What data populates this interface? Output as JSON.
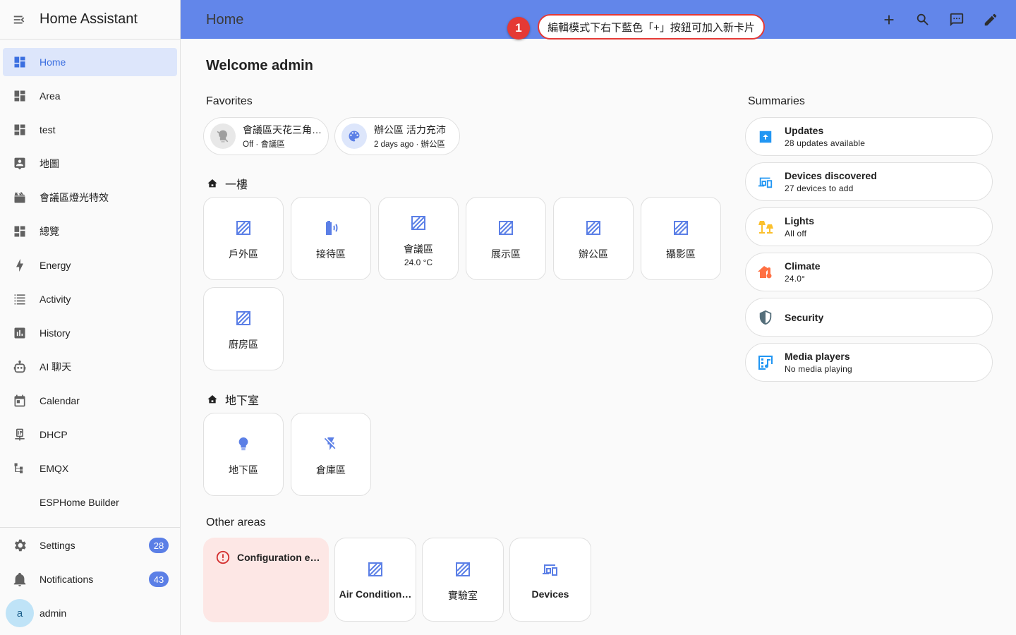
{
  "app": {
    "title": "Home Assistant"
  },
  "sidebar": {
    "items": [
      {
        "label": "Home",
        "icon": "dashboard-icon",
        "selected": true
      },
      {
        "label": "Area",
        "icon": "dashboard-icon"
      },
      {
        "label": "test",
        "icon": "dashboard-icon"
      },
      {
        "label": "地圖",
        "icon": "map-account-icon"
      },
      {
        "label": "會議區燈光特效",
        "icon": "movie-open-icon"
      },
      {
        "label": "總覽",
        "icon": "dashboard-icon"
      },
      {
        "label": "Energy",
        "icon": "lightning-bolt-icon"
      },
      {
        "label": "Activity",
        "icon": "format-list-bulleted-icon"
      },
      {
        "label": "History",
        "icon": "chart-box-icon"
      },
      {
        "label": "AI 聊天",
        "icon": "robot-icon"
      },
      {
        "label": "Calendar",
        "icon": "calendar-icon"
      },
      {
        "label": "DHCP",
        "icon": "ip-network-icon"
      },
      {
        "label": "EMQX",
        "icon": "sitemap-icon"
      },
      {
        "label": "ESPHome Builder",
        "icon": ""
      }
    ],
    "bottom": {
      "settings": {
        "label": "Settings",
        "badge": "28"
      },
      "notifications": {
        "label": "Notifications",
        "badge": "43"
      },
      "user": {
        "label": "admin",
        "initial": "a"
      }
    }
  },
  "topbar": {
    "title": "Home",
    "actions": [
      "add-icon",
      "search-icon",
      "assist-chat-icon",
      "edit-pencil-icon"
    ],
    "tip": {
      "number": "1",
      "text": "編輯模式下右下藍色「+」按鈕可加入新卡片"
    }
  },
  "main": {
    "welcome": "Welcome admin",
    "favorites": {
      "title": "Favorites",
      "items": [
        {
          "name": "會議區天花三角…",
          "sub": "Off · 會議區",
          "icon": "lightbulb-off-icon"
        },
        {
          "name": "辦公區 活力充沛",
          "sub": "2 days ago · 辦公區",
          "icon": "palette-icon"
        }
      ]
    },
    "floors": [
      {
        "title": "一樓",
        "areas": [
          {
            "name": "戶外區",
            "icon": "area-placeholder-icon"
          },
          {
            "name": "接待區",
            "icon": "battery-sound-icon"
          },
          {
            "name": "會議區",
            "temp": "24.0 °C",
            "icon": "area-placeholder-icon"
          },
          {
            "name": "展示區",
            "icon": "area-placeholder-icon"
          },
          {
            "name": "辦公區",
            "icon": "area-placeholder-icon"
          },
          {
            "name": "攝影區",
            "icon": "area-placeholder-icon"
          },
          {
            "name": "廚房區",
            "icon": "area-placeholder-icon"
          }
        ]
      },
      {
        "title": "地下室",
        "areas": [
          {
            "name": "地下區",
            "icon": "lightbulb-icon"
          },
          {
            "name": "倉庫區",
            "icon": "flash-off-icon"
          }
        ]
      }
    ],
    "other_areas": {
      "title": "Other areas",
      "error": {
        "text": "Configuration er…",
        "icon": "alert-circle-icon"
      },
      "items": [
        {
          "name": "Air Condition…",
          "icon": "area-placeholder-icon"
        },
        {
          "name": "實驗室",
          "icon": "area-placeholder-icon"
        },
        {
          "name": "Devices",
          "icon": "devices-icon"
        }
      ]
    },
    "summaries": {
      "title": "Summaries",
      "items": [
        {
          "name": "Updates",
          "sub": "28 updates available",
          "icon": "package-up-icon",
          "color": "#2196f3"
        },
        {
          "name": "Devices discovered",
          "sub": "27 devices to add",
          "icon": "devices-icon",
          "color": "#2196f3"
        },
        {
          "name": "Lights",
          "sub": "All off",
          "icon": "lamps-icon",
          "color": "#fbc02d"
        },
        {
          "name": "Climate",
          "sub": "24.0°",
          "icon": "home-thermometer-icon",
          "color": "#ff7043"
        },
        {
          "name": "Security",
          "sub": "",
          "icon": "shield-half-icon",
          "color": "#546e7a"
        },
        {
          "name": "Media players",
          "sub": "No media playing",
          "icon": "multimedia-icon",
          "color": "#2196f3"
        }
      ]
    }
  },
  "colors": {
    "primary": "#6286ea",
    "accent": "#3b6fe0",
    "selected_bg": "#dde6fb",
    "badge": "#5b7fe6",
    "tip_red": "#e53935",
    "error_bg": "#fde7e5"
  }
}
